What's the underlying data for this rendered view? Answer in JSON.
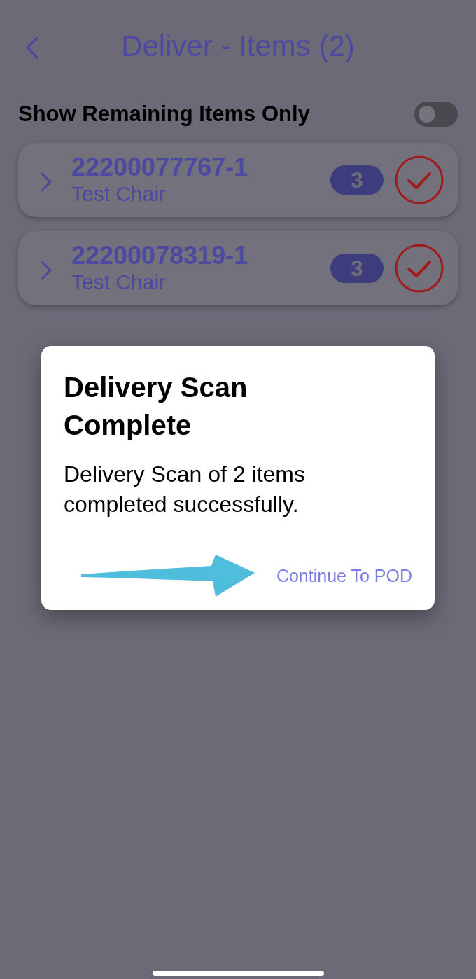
{
  "header": {
    "title": "Deliver - Items (2)"
  },
  "filter": {
    "label": "Show Remaining Items Only",
    "on": false
  },
  "items": [
    {
      "number": "22200077767-1",
      "name": "Test Chair",
      "count": "3",
      "scanned": true
    },
    {
      "number": "22200078319-1",
      "name": "Test Chair",
      "count": "3",
      "scanned": true
    }
  ],
  "dialog": {
    "title": "Delivery Scan Complete",
    "message": "Delivery Scan of 2 items completed successfully.",
    "action": "Continue To POD"
  }
}
